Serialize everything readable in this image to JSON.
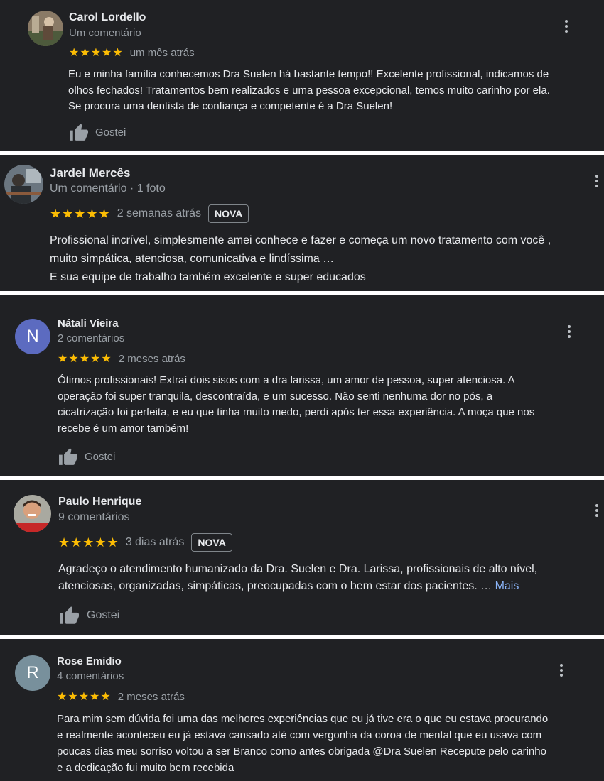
{
  "colors": {
    "card_bg": "#202124",
    "separator": "#ffffff",
    "star": "#fbbc04",
    "link": "#8ab4f8",
    "avatar_natali": "#5c6bc0",
    "avatar_rose": "#78909c"
  },
  "reviews": [
    {
      "name": "Carol Lordello",
      "meta": "Um comentário",
      "stars": "★★★★★",
      "date": "um mês atrás",
      "text_lines": [
        "Eu e minha família conhecemos Dra Suelen há bastante tempo!! Excelente profissional, indicamos de",
        "olhos fechados! Tratamentos bem realizados e uma pessoa excepcional, temos muito carinho por ela.",
        "Se procura uma dentista de confiança e competente é a Dra Suelen!"
      ],
      "like_label": "Gostei",
      "avatar_icon": "photo-avatar-icon"
    },
    {
      "name": "Jardel Mercês",
      "meta": "Um comentário · 1 foto",
      "stars": "★★★★★",
      "date": "2 semanas atrás",
      "badge": "NOVA",
      "text_lines": [
        "Profissional incrível, simplesmente amei conhece e fazer e começa um novo tratamento com você ,",
        "muito simpática, atenciosa, comunicativa e lindíssima …",
        "E sua equipe de trabalho também excelente e super educados"
      ],
      "avatar_icon": "photo-avatar-icon"
    },
    {
      "name": "Nátali Vieira",
      "meta": "2 comentários",
      "stars": "★★★★★",
      "date": "2 meses atrás",
      "avatar_letter": "N",
      "text_lines": [
        "Ótimos profissionais! Extraí dois sisos com a dra larissa, um amor de pessoa, super atenciosa. A",
        "operação foi super tranquila, descontraída, e um sucesso. Não senti nenhuma dor no pós, a",
        "cicatrização foi perfeita, e eu que tinha muito medo, perdi após ter essa experiência. A moça que nos",
        "recebe é um amor também!"
      ],
      "like_label": "Gostei"
    },
    {
      "name": "Paulo Henrique",
      "meta": "9 comentários",
      "stars": "★★★★★",
      "date": "3 dias atrás",
      "badge": "NOVA",
      "text_lines": [
        "Agradeço o atendimento humanizado da Dra. Suelen e Dra. Larissa, profissionais de alto nível,",
        "atenciosas, organizadas, simpáticas, preocupadas com o bem estar dos pacientes. …"
      ],
      "more_label": "Mais",
      "like_label": "Gostei",
      "avatar_icon": "photo-avatar-icon"
    },
    {
      "name": "Rose Emidio",
      "meta": "4 comentários",
      "stars": "★★★★★",
      "date": "2 meses atrás",
      "avatar_letter": "R",
      "text_lines": [
        "Para mim sem dúvida foi uma das melhores experiências que eu já tive era o que eu estava procurando",
        "e realmente aconteceu eu já estava cansado até com vergonha da coroa de mental que eu usava com",
        "poucas dias meu sorriso voltou a ser Branco como antes obrigada  @Dra Suelen Recepute pelo carinho",
        "e a dedicação fui muito bem recebida"
      ]
    }
  ]
}
